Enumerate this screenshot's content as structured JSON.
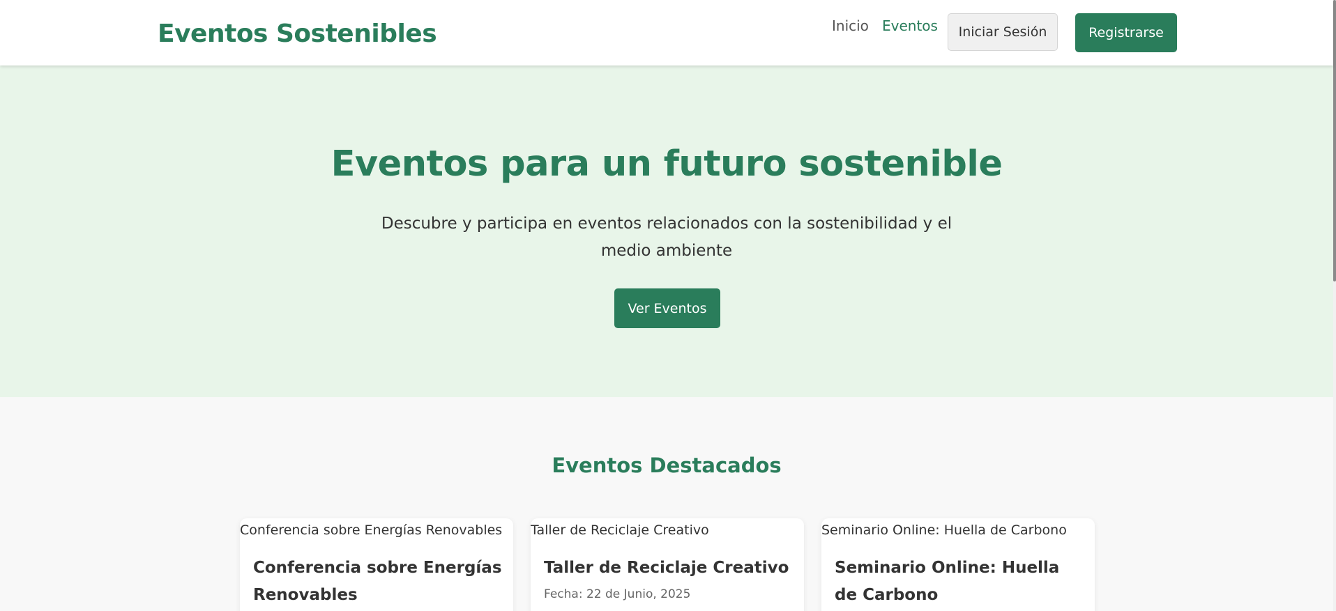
{
  "nav": {
    "logo": "Eventos Sostenibles",
    "links": [
      {
        "label": "Inicio",
        "active": false
      },
      {
        "label": "Eventos",
        "active": true
      }
    ],
    "login_label": "Iniciar Sesión",
    "register_label": "Registrarse"
  },
  "hero": {
    "title": "Eventos para un futuro sostenible",
    "subtitle": "Descubre y participa en eventos relacionados con la sostenibilidad y el medio ambiente",
    "cta_label": "Ver Eventos"
  },
  "featured": {
    "title": "Eventos Destacados",
    "cards": [
      {
        "image_alt": "Conferencia sobre Energías Renovables",
        "title": "Conferencia sobre Energías Renovables",
        "date": ""
      },
      {
        "image_alt": "Taller de Reciclaje Creativo",
        "title": "Taller de Reciclaje Creativo",
        "date": "Fecha: 22 de Junio, 2025"
      },
      {
        "image_alt": "Seminario Online: Huella de Carbono",
        "title": "Seminario Online: Huella de Carbono",
        "date": ""
      }
    ]
  },
  "colors": {
    "brand": "#2a7d5b",
    "hero_bg": "#e8f5e9",
    "page_bg": "#f8f8f8"
  }
}
